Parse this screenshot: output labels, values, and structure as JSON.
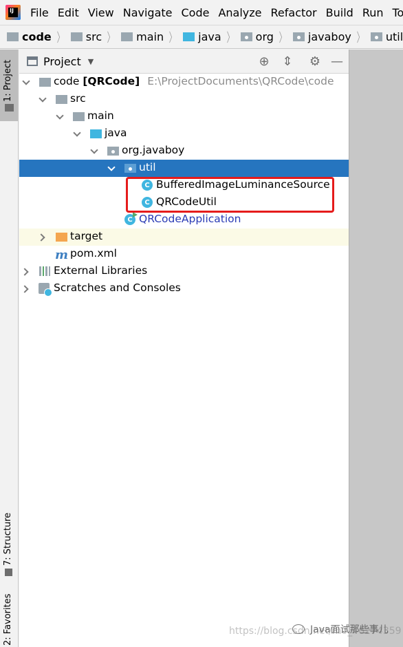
{
  "menu": {
    "logo_text": "IJ",
    "items": [
      "File",
      "Edit",
      "View",
      "Navigate",
      "Code",
      "Analyze",
      "Refactor",
      "Build",
      "Run",
      "Tools"
    ]
  },
  "breadcrumb": [
    "code",
    "src",
    "main",
    "java",
    "org",
    "javaboy",
    "util"
  ],
  "left_tabs": {
    "project": "1: Project",
    "structure": "7: Structure",
    "favorites": "2: Favorites"
  },
  "panel": {
    "title": "Project"
  },
  "tree": {
    "root_name": "code",
    "root_module": "[QRCode]",
    "root_path": "E:\\ProjectDocuments\\QRCode\\code",
    "src": "src",
    "main": "main",
    "java": "java",
    "package": "org.javaboy",
    "util": "util",
    "class1": "BufferedImageLuminanceSource",
    "class2": "QRCodeUtil",
    "app_class": "QRCodeApplication",
    "target": "target",
    "pom": "pom.xml",
    "ext_libs": "External Libraries",
    "scratches": "Scratches and Consoles"
  },
  "icons": {
    "class_glyph": "C",
    "maven_glyph": "m",
    "locate": "⊕",
    "collapse": "⇕",
    "settings": "⚙",
    "hide": "—"
  },
  "watermark": {
    "url": "https://blog.csdn.net/m0_46274359",
    "brand": "Java面试那些事儿"
  },
  "colors": {
    "selection": "#2675bf",
    "annotation": "#e51b1b",
    "app_class_text": "#2a3bb5"
  }
}
